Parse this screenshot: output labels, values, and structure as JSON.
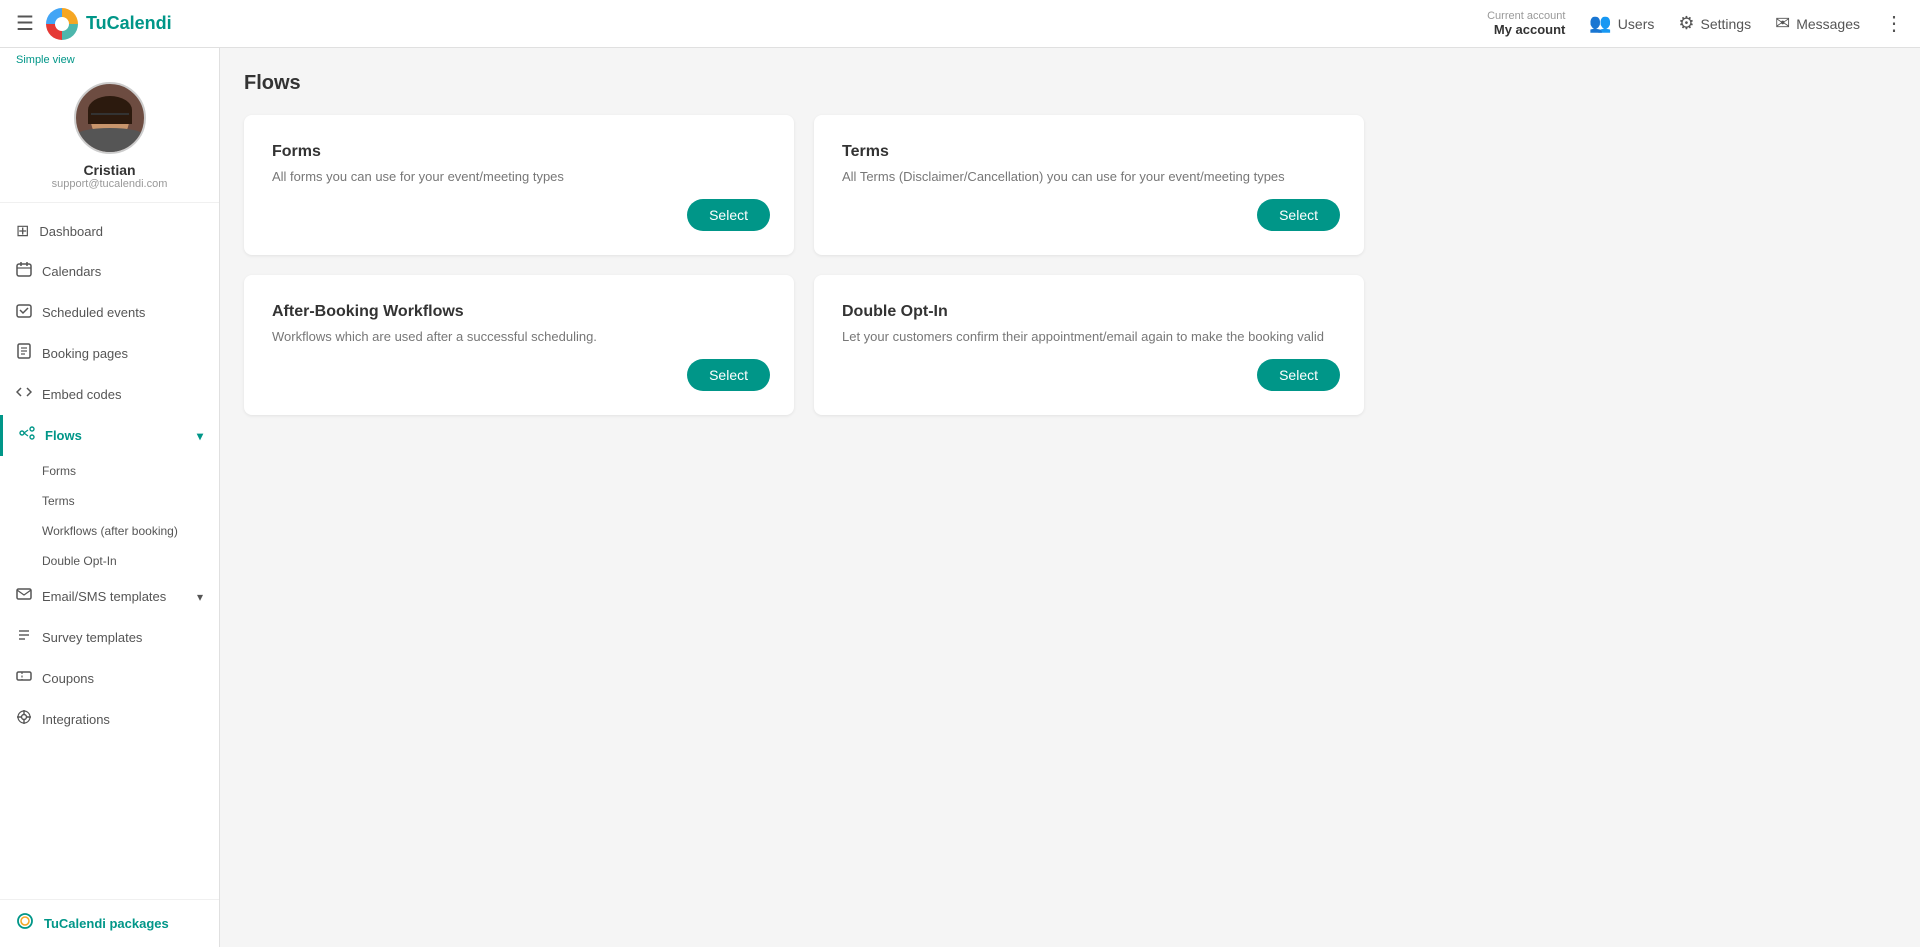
{
  "navbar": {
    "hamburger_label": "☰",
    "logo_text_before": "Tu",
    "logo_text_after": "Calendi",
    "account_label": "Current account",
    "account_value": "My account",
    "users_label": "Users",
    "settings_label": "Settings",
    "messages_label": "Messages"
  },
  "sidebar": {
    "simple_view": "Simple view",
    "profile": {
      "name": "Cristian",
      "email": "support@tucalendi.com"
    },
    "items": [
      {
        "id": "dashboard",
        "label": "Dashboard",
        "icon": "⊞"
      },
      {
        "id": "calendars",
        "label": "Calendars",
        "icon": "📅"
      },
      {
        "id": "scheduled-events",
        "label": "Scheduled events",
        "icon": "✓"
      },
      {
        "id": "booking-pages",
        "label": "Booking pages",
        "icon": "🗒"
      },
      {
        "id": "embed-codes",
        "label": "Embed codes",
        "icon": "</>"
      },
      {
        "id": "flows",
        "label": "Flows",
        "icon": "⋮→",
        "expanded": true
      },
      {
        "id": "email-sms",
        "label": "Email/SMS templates",
        "icon": "✉",
        "hasChevron": true
      },
      {
        "id": "survey-templates",
        "label": "Survey templates",
        "icon": "≡"
      },
      {
        "id": "coupons",
        "label": "Coupons",
        "icon": "🎟"
      },
      {
        "id": "integrations",
        "label": "Integrations",
        "icon": "⚙"
      }
    ],
    "flows_subitems": [
      {
        "id": "forms",
        "label": "Forms"
      },
      {
        "id": "terms",
        "label": "Terms"
      },
      {
        "id": "workflows",
        "label": "Workflows (after booking)"
      },
      {
        "id": "double-opt-in",
        "label": "Double Opt-In"
      }
    ],
    "packages": {
      "label": "TuCalendi packages",
      "icon": "⟳"
    }
  },
  "main": {
    "page_title": "Flows",
    "cards": [
      {
        "id": "forms",
        "title": "Forms",
        "description": "All forms you can use for your event/meeting types",
        "button_label": "Select"
      },
      {
        "id": "terms",
        "title": "Terms",
        "description": "All Terms (Disclaimer/Cancellation) you can use for your event/meeting types",
        "button_label": "Select"
      },
      {
        "id": "after-booking",
        "title": "After-Booking Workflows",
        "description": "Workflows which are used after a successful scheduling.",
        "button_label": "Select"
      },
      {
        "id": "double-opt-in",
        "title": "Double Opt-In",
        "description": "Let your customers confirm their appointment/email again to make the booking valid",
        "button_label": "Select"
      }
    ]
  }
}
